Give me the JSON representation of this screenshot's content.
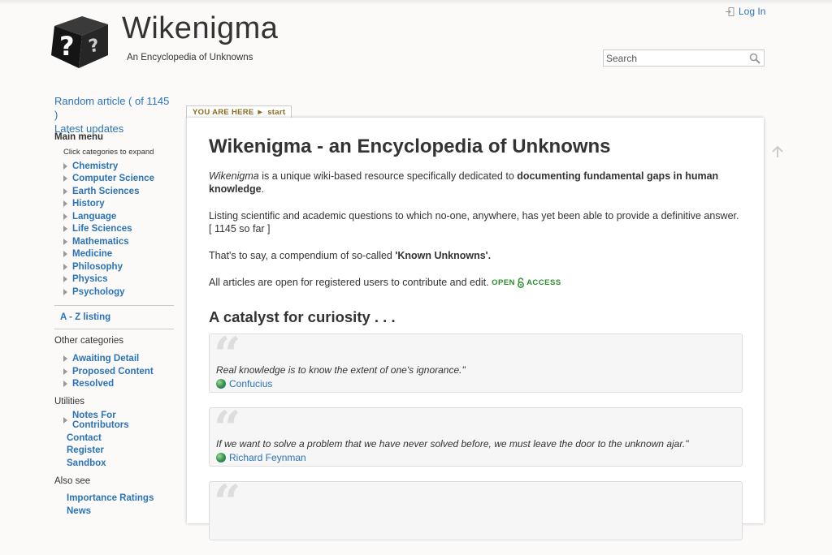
{
  "header": {
    "title": "Wikenigma",
    "subtitle": "An Encyclopedia of Unknowns",
    "login_label": "Log In",
    "search_placeholder": "Search"
  },
  "sidebar": {
    "random_article": "Random article ( of 1145 )",
    "latest_updates": "Latest updates",
    "main_menu": "Main menu",
    "expand_note": "Click categories to expand",
    "categories": [
      "Chemistry",
      "Computer Science",
      "Earth Sciences",
      "History",
      "Language",
      "Life Sciences",
      "Mathematics",
      "Medicine",
      "Philosophy",
      "Physics",
      "Psychology"
    ],
    "az_listing": "A - Z listing",
    "other_categories_title": "Other categories",
    "other_categories": [
      "Awaiting Detail",
      "Proposed Content",
      "Resolved"
    ],
    "utilities_title": "Utilities",
    "utilities": [
      "Notes For Contributors"
    ],
    "utility_links": [
      "Contact",
      "Register",
      "Sandbox"
    ],
    "also_see_title": "Also see",
    "also_see": [
      "Importance Ratings",
      "News"
    ]
  },
  "breadcrumb": {
    "label": "YOU ARE HERE ►",
    "current": "start"
  },
  "main": {
    "heading": "Wikenigma - an Encyclopedia of Unknowns",
    "intro_italic": "Wikenigma",
    "intro_rest": " is a unique wiki-based resource specifically dedicated to ",
    "intro_bold": "documenting fundamental gaps in human knowledge",
    "intro_end": ".",
    "listing": "Listing scientific and academic questions to which no-one, anywhere, has yet been able to provide a definitive answer. [ 1145 so far ]",
    "compendium_pre": "That's to say, a compendium of so-called ",
    "compendium_bold": "'Known Unknowns'.",
    "open_text": "All articles are open for registered users to contribute and edit.",
    "open_access_a": "OPEN",
    "open_access_b": "ACCESS",
    "subheading": "A catalyst for curiosity . . .",
    "quotes": [
      {
        "text": "Real knowledge is to know the extent of one's ignorance.\"",
        "author": "Confucius"
      },
      {
        "text": "If we want to solve a problem that we have never solved before, we must leave the door to the unknown ajar.\"",
        "author": "Richard Feynman"
      },
      {
        "text": "",
        "author": ""
      }
    ]
  },
  "colors": {
    "link": "#2b73b7",
    "breadcrumb": "#8b6b1e",
    "open_access": "#2a8f2a"
  }
}
